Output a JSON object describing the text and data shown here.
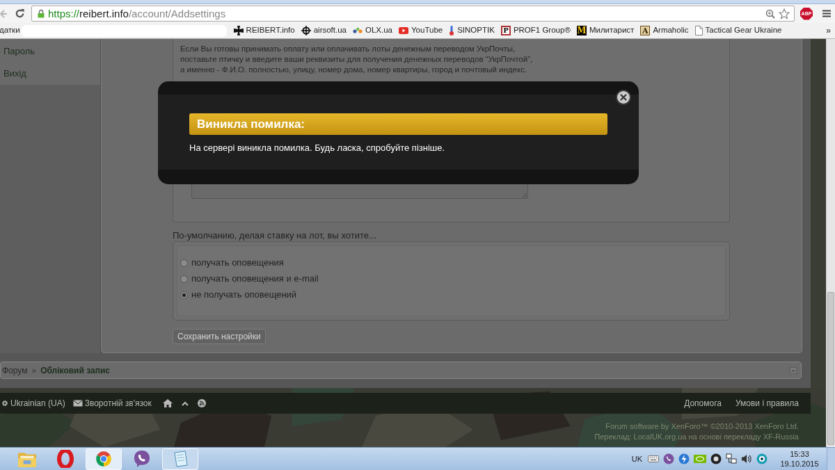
{
  "browser": {
    "url": {
      "scheme": "https://",
      "host": "reibert.info",
      "path": "/account/Addsettings"
    },
    "abp_label": "ABP",
    "bookmarks_folder": "датки",
    "bookmarks": [
      {
        "kind": "cross",
        "label": "REIBERT.info"
      },
      {
        "kind": "crosshair",
        "label": "airsoft.ua"
      },
      {
        "kind": "dots",
        "label": "OLX.ua"
      },
      {
        "kind": "play",
        "label": "YouTube"
      },
      {
        "kind": "thermometer",
        "label": "SINOPTIK"
      },
      {
        "kind": "letter-framed",
        "letter": "P",
        "label": "PROF1 Group®"
      },
      {
        "kind": "letter-dark",
        "letter": "M",
        "label": "Милитарист"
      },
      {
        "kind": "letter-tan",
        "letter": "A",
        "label": "Armaholic"
      },
      {
        "kind": "page",
        "label": "Tactical Gear Ukraine"
      }
    ],
    "bookmarks_overflow": "»"
  },
  "sidebar": {
    "items": [
      "Пароль",
      "Вихід"
    ]
  },
  "settings": {
    "ukrposhta_description": "Если Вы готовы принимать оплату или оплачивать лоты денежным переводом УкрПочты,\nпоставьте птичку и введите ваши реквизиты для получения денежных переводов “УкрПочтой”,\nа именно - Ф.И.О. полностью, улицу, номер дома, номер квартиры, город и почтовый индекс.",
    "notify": {
      "label": "По-умолчанию, делая ставку на лот, вы хотите...",
      "options": [
        {
          "label": "получать оповещения",
          "selected": false
        },
        {
          "label": "получать оповещения и e-mail",
          "selected": false
        },
        {
          "label": "не получать оповещений",
          "selected": true
        }
      ]
    },
    "save_button": "Сохранить настройки"
  },
  "breadcrumb": {
    "items": [
      "Форум",
      "Обліковий запис"
    ],
    "separator": "»"
  },
  "footer": {
    "links_left": [
      {
        "kind": "language",
        "label": "Ukrainian (UA)"
      },
      {
        "kind": "contact",
        "label": "Зворотній зв'язок"
      }
    ],
    "links_right": [
      "Допомога",
      "Умови і правила"
    ],
    "credits": [
      "Forum software by XenForo™ ©2010-2013 XenForo Ltd.",
      "Переклад: LocalUK.org.ua на основі перекладу XF-Russia"
    ]
  },
  "modal": {
    "title": "Виникла помилка:",
    "message": "На сервері виникла помилка. Будь ласка, спробуйте пізніше."
  },
  "taskbar": {
    "apps": [
      {
        "kind": "explorer",
        "selected": false,
        "running": false
      },
      {
        "kind": "opera",
        "selected": false,
        "running": false
      },
      {
        "kind": "chrome",
        "selected": true,
        "running": true
      },
      {
        "kind": "viber",
        "selected": false,
        "running": false
      },
      {
        "kind": "notepad",
        "selected": false,
        "running": true
      }
    ],
    "language": "UK",
    "time": "15:33",
    "date": "19.10.2015"
  }
}
